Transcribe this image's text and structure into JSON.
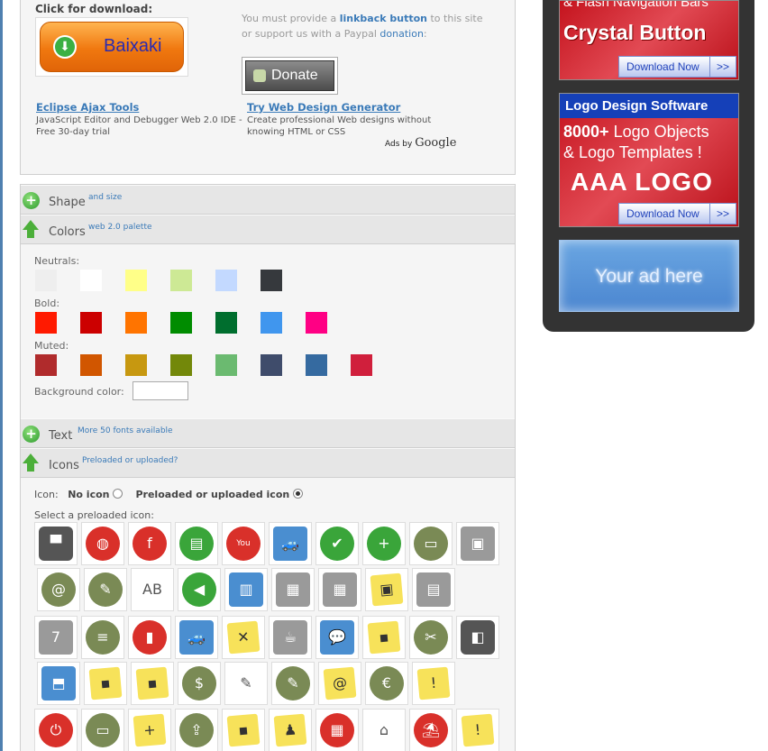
{
  "download": {
    "title": "Click for download:",
    "button_label": "Baixaki"
  },
  "support": {
    "text_1": "You must provide a ",
    "linkback": "linkback button",
    "text_2": " to this site or support us with a Paypal ",
    "donation": "donation",
    "text_3": ":",
    "donate_label": "Donate"
  },
  "ads": [
    {
      "title": "Eclipse Ajax Tools",
      "desc": "JavaScript Editor and Debugger Web 2.0 IDE - Free 30-day trial"
    },
    {
      "title": "Try Web Design Generator",
      "desc": "Create professional Web designs without knowing HTML or CSS"
    }
  ],
  "ads_by": {
    "prefix": "Ads by",
    "brand": "Google"
  },
  "sections": {
    "shape": {
      "title": "Shape",
      "sub": "and size"
    },
    "colors": {
      "title": "Colors",
      "sub": "web 2.0 palette"
    },
    "text": {
      "title": "Text",
      "sub": "More 50 fonts available"
    },
    "icons": {
      "title": "Icons",
      "sub": "Preloaded or uploaded?"
    }
  },
  "colors": {
    "neutrals_label": "Neutrals:",
    "bold_label": "Bold:",
    "muted_label": "Muted:",
    "background_label": "Background color:",
    "neutrals": [
      "#eeeeee",
      "#ffffff",
      "#ffff88",
      "#cde995",
      "#c3d9ff",
      "#36393d"
    ],
    "bold": [
      "#ff1a00",
      "#cc0000",
      "#ff7400",
      "#008c00",
      "#006e2e",
      "#4096ee",
      "#ff0084"
    ],
    "muted": [
      "#b02b2c",
      "#d15600",
      "#c79810",
      "#73880a",
      "#6bba70",
      "#3f4c6b",
      "#356aa0",
      "#d01f3c"
    ]
  },
  "icons": {
    "icon_label": "Icon:",
    "no_icon": "No icon",
    "preloaded": "Preloaded or uploaded icon",
    "select_label": "Select a preloaded icon:",
    "rows": [
      [
        "▀",
        "◍",
        "f",
        "▤",
        "You Tube",
        "🚙",
        "✔",
        "+",
        "▭",
        "▣"
      ],
      [
        "@",
        "✎",
        "AB",
        "◀",
        "▥",
        "▦",
        "▦",
        "▣",
        "▤"
      ],
      [
        "7",
        "≡",
        "▮",
        "🚙",
        "✕",
        "☕",
        "💬",
        "▪",
        "✂",
        "◧"
      ],
      [
        "⬒",
        "▪",
        "▪",
        "$",
        "✎",
        "✎",
        "@",
        "€",
        "!"
      ],
      [
        "⏻",
        "▭",
        "+",
        "⇪",
        "▪",
        "♟",
        "▦",
        "⌂",
        "⛱",
        "!"
      ]
    ]
  },
  "sidebar": {
    "ad1_top": "& Flash Navigation Bars",
    "ad1_big": "Crystal Button",
    "download_now": "Download Now",
    "arrows": ">>",
    "ad2_head": "Logo Design Software",
    "ad2_line1_num": "8000+",
    "ad2_line1_rest": " Logo Objects",
    "ad2_line2": "& Logo Templates !",
    "ad2_big": "AAA LOGO",
    "ad3": "Your ad here"
  }
}
